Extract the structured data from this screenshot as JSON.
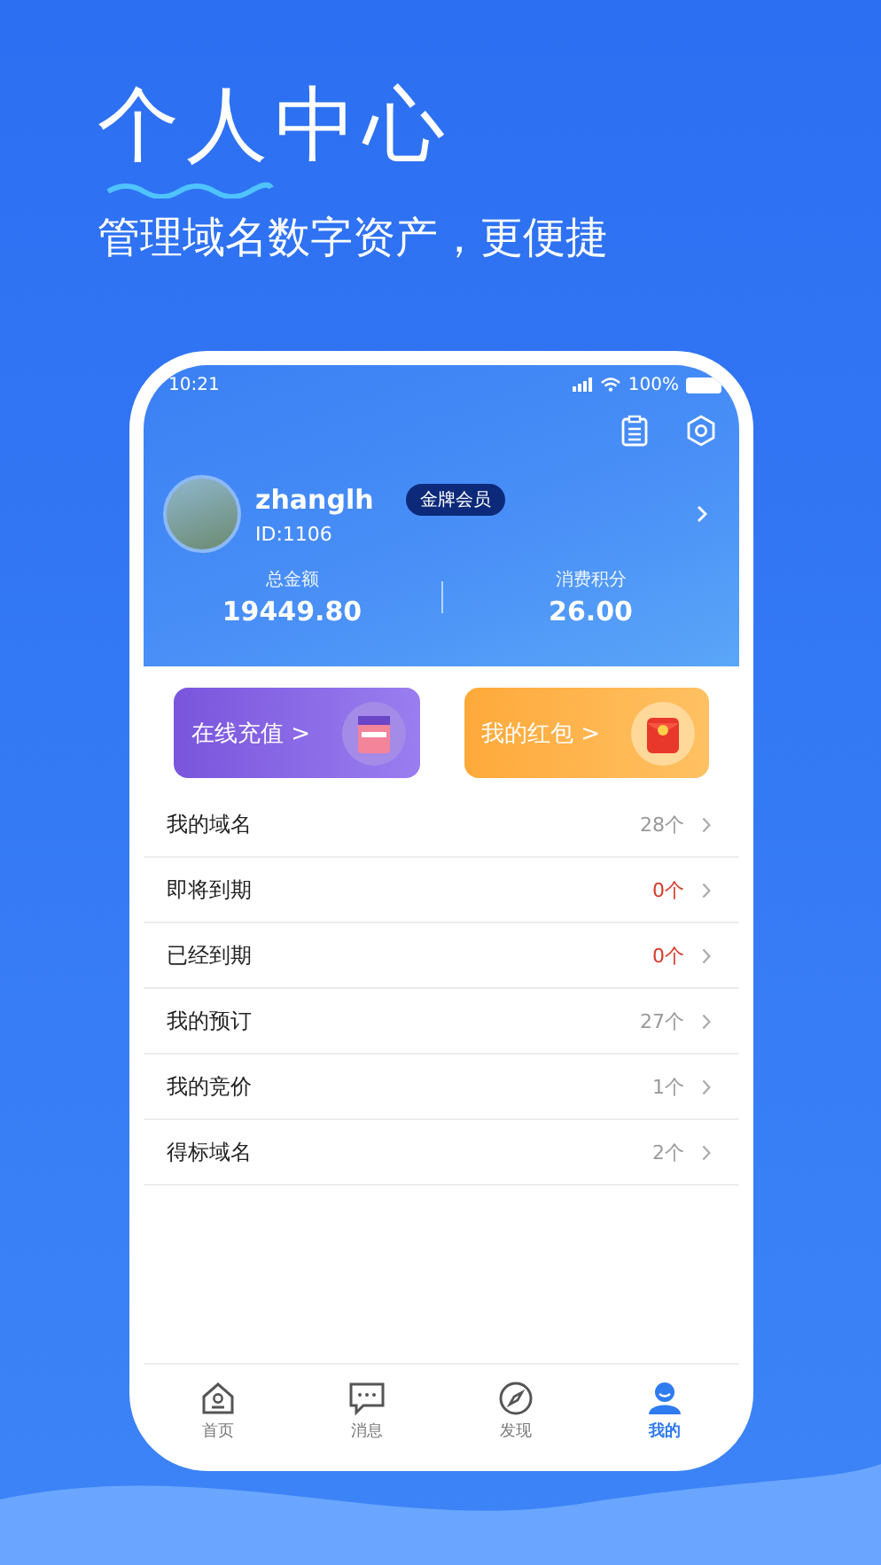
{
  "promo": {
    "title": "个人中心",
    "subtitle": "管理域名数字资产，更便捷"
  },
  "status_bar": {
    "time": "10:21",
    "battery": "100%"
  },
  "profile": {
    "username": "zhanglh",
    "badge": "金牌会员",
    "user_id": "ID:1106"
  },
  "stats": [
    {
      "label": "总金额",
      "value": "19449.80"
    },
    {
      "label": "消费积分",
      "value": "26.00"
    }
  ],
  "cards": [
    {
      "kind": "wallet",
      "label": "在线充值",
      "chevron": ">"
    },
    {
      "kind": "envelope",
      "label": "我的红包",
      "chevron": ">"
    }
  ],
  "menu": [
    {
      "label": "我的域名",
      "count": "28个",
      "color": "#999999"
    },
    {
      "label": "即将到期",
      "count": "0个",
      "color": "#d63a2a"
    },
    {
      "label": "已经到期",
      "count": "0个",
      "color": "#d63a2a"
    },
    {
      "label": "我的预订",
      "count": "27个",
      "color": "#999999"
    },
    {
      "label": "我的竞价",
      "count": "1个",
      "color": "#999999"
    },
    {
      "label": "得标域名",
      "count": "2个",
      "color": "#999999"
    }
  ],
  "tabs": [
    {
      "kind": "home",
      "label": "首页",
      "selected": false
    },
    {
      "kind": "message",
      "label": "消息",
      "selected": false
    },
    {
      "kind": "compass",
      "label": "发现",
      "selected": false
    },
    {
      "kind": "person",
      "label": "我的",
      "selected": true
    }
  ]
}
